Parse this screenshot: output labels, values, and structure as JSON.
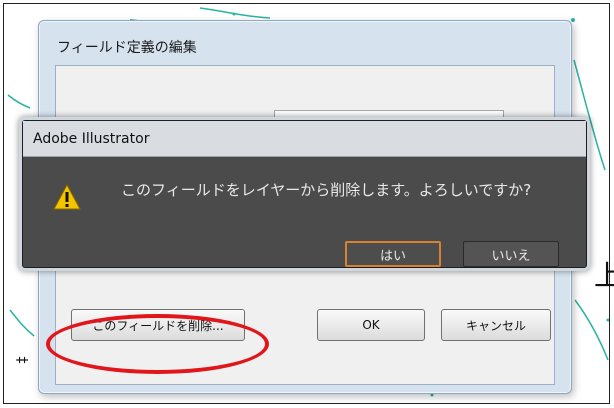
{
  "field_dialog": {
    "title": "フィールド定義の編集",
    "delete_button": "このフィールドを削除...",
    "ok_button": "OK",
    "cancel_button": "キャンセル"
  },
  "alert": {
    "title": "Adobe Illustrator",
    "icon": "warning-icon",
    "message": "このフィールドをレイヤーから削除します。よろしいですか?",
    "yes_button": "はい",
    "no_button": "いいえ"
  },
  "background": {
    "right_text": "上"
  },
  "colors": {
    "annotation_red": "#e0161b",
    "alert_bg": "#4b4b4b",
    "default_button_border": "#d78230",
    "map_lines": "#2ab3a3"
  }
}
